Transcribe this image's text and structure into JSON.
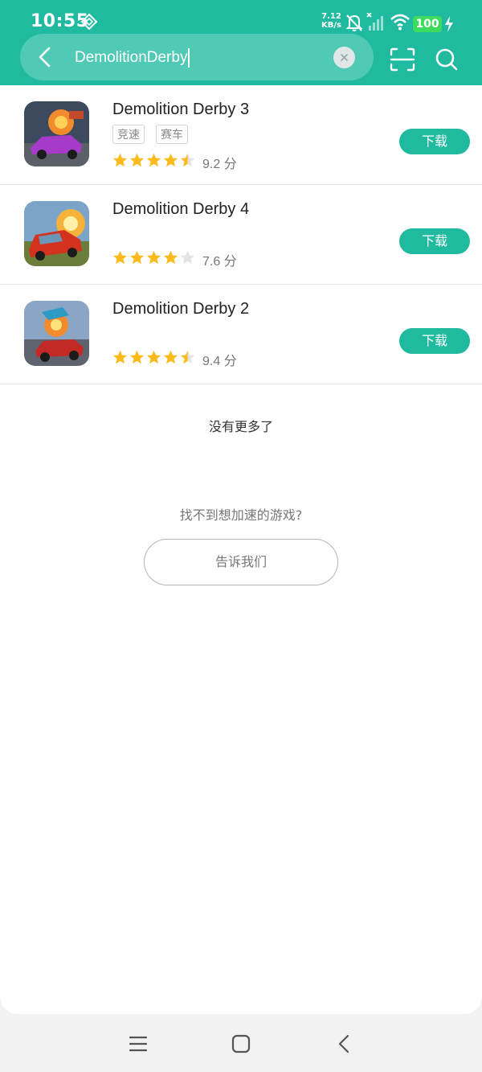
{
  "status": {
    "time": "10:55",
    "net_speed": "7.12",
    "net_unit": "KB/s",
    "battery": "100"
  },
  "search": {
    "query": "DemolitionDerby"
  },
  "results": [
    {
      "name": "Demolition Derby 3",
      "tags": [
        "竞速",
        "赛车"
      ],
      "rating": 4.5,
      "score": "9.2 分",
      "button": "下载"
    },
    {
      "name": "Demolition Derby 4",
      "tags": [],
      "rating": 4.0,
      "score": "7.6 分",
      "button": "下载"
    },
    {
      "name": "Demolition Derby 2",
      "tags": [],
      "rating": 4.5,
      "score": "9.4 分",
      "button": "下载"
    }
  ],
  "footer": {
    "no_more": "没有更多了",
    "not_found": "找不到想加速的游戏?",
    "tell_us": "告诉我们"
  },
  "icons": {
    "back": "chevron-left-icon",
    "clear": "close-icon",
    "scan": "scan-icon",
    "search": "search-icon"
  },
  "colors": {
    "accent": "#1fbaa0",
    "star": "#fbbb1a",
    "star_empty": "#e3e3e3"
  }
}
